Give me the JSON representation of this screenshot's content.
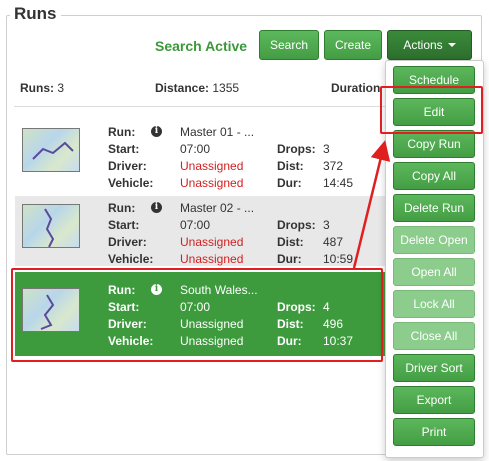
{
  "legend": "Runs",
  "toolbar": {
    "status": "Search Active",
    "search_label": "Search",
    "create_label": "Create",
    "actions_label": "Actions"
  },
  "summary": {
    "runs_label": "Runs:",
    "runs_value": "3",
    "distance_label": "Distance:",
    "distance_value": "1355",
    "duration_label": "Duration"
  },
  "labels": {
    "run": "Run:",
    "start": "Start:",
    "driver": "Driver:",
    "vehicle": "Vehicle:",
    "drops": "Drops:",
    "dist": "Dist:",
    "dur": "Dur:"
  },
  "runs": [
    {
      "name": "Master 01 - ...",
      "start": "07:00",
      "driver": "Unassigned",
      "vehicle": "Unassigned",
      "drops": "3",
      "dist": "372",
      "dur": "14:45"
    },
    {
      "name": "Master 02 - ...",
      "start": "07:00",
      "driver": "Unassigned",
      "vehicle": "Unassigned",
      "drops": "3",
      "dist": "487",
      "dur": "10:59"
    },
    {
      "name": "South Wales...",
      "start": "07:00",
      "driver": "Unassigned",
      "vehicle": "Unassigned",
      "drops": "4",
      "dist": "496",
      "dur": "10:37"
    }
  ],
  "menu": [
    {
      "label": "Schedule",
      "enabled": true
    },
    {
      "label": "Edit",
      "enabled": true
    },
    {
      "label": "Copy Run",
      "enabled": true
    },
    {
      "label": "Copy All",
      "enabled": true
    },
    {
      "label": "Delete Run",
      "enabled": true
    },
    {
      "label": "Delete Open",
      "enabled": false
    },
    {
      "label": "Open All",
      "enabled": false
    },
    {
      "label": "Lock All",
      "enabled": false
    },
    {
      "label": "Close All",
      "enabled": false
    },
    {
      "label": "Driver Sort",
      "enabled": true
    },
    {
      "label": "Export",
      "enabled": true
    },
    {
      "label": "Print",
      "enabled": true
    }
  ],
  "colors": {
    "primary_green": "#449d44",
    "selected_row": "#3d9a3d",
    "unassigned_red": "#d21f1f",
    "annotation_red": "#e02020"
  }
}
